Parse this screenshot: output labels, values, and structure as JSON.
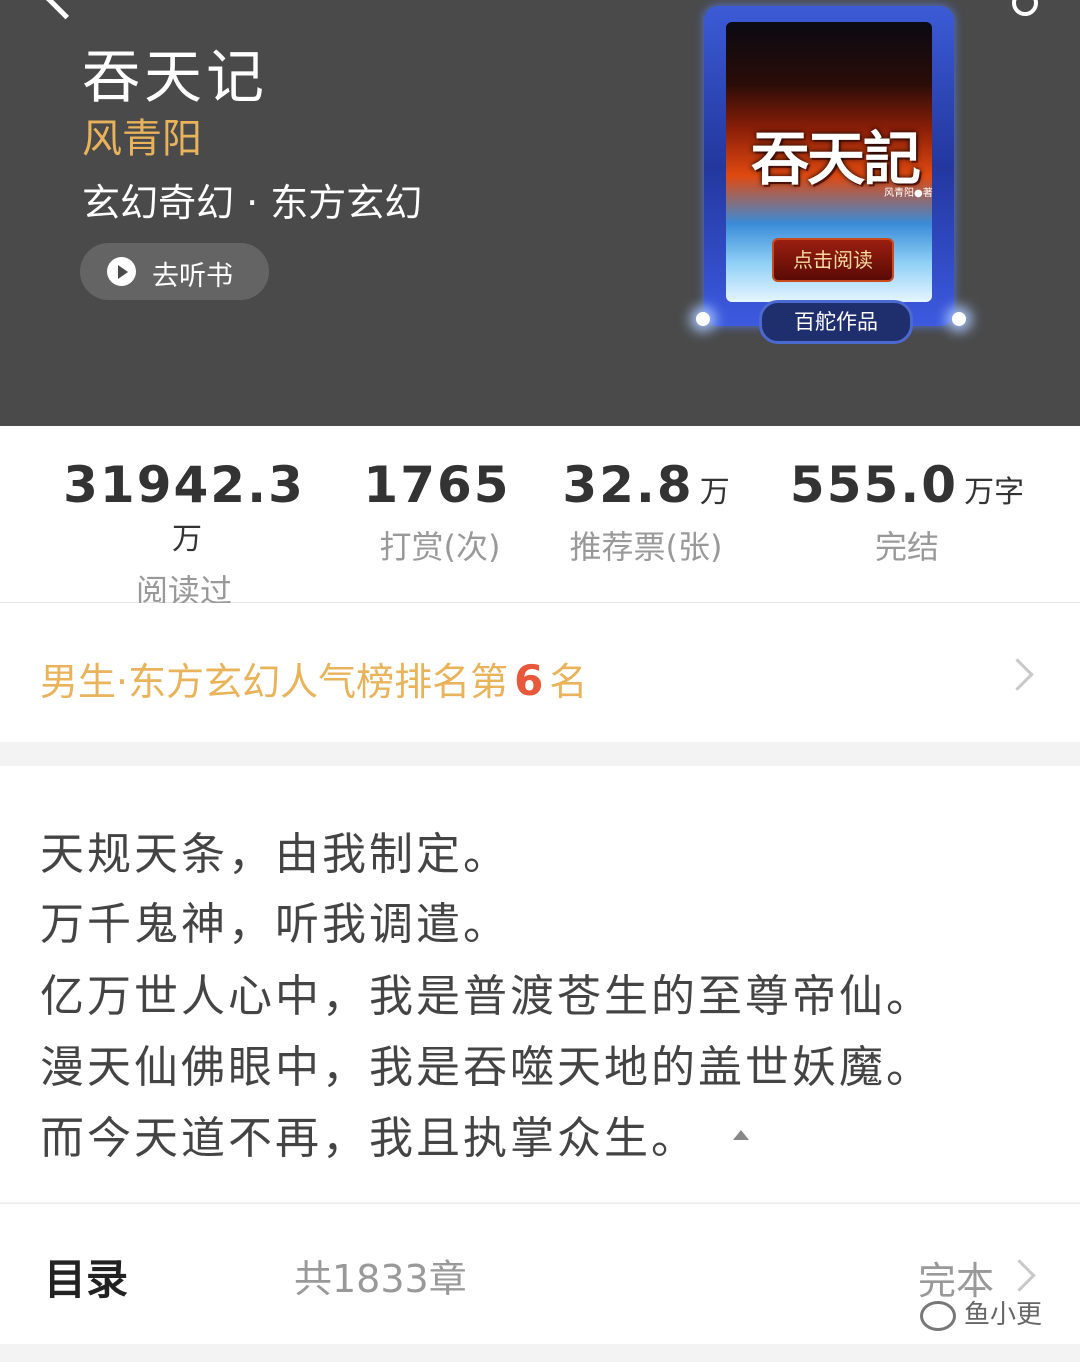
{
  "header": {
    "book_title": "吞天记",
    "author": "风青阳",
    "genre": "玄幻奇幻 · 东方玄幻",
    "listen_button": "去听书",
    "cover": {
      "title": "吞天記",
      "author_mark": "风青阳●著",
      "read_button": "点击阅读",
      "badge": "百舵作品"
    }
  },
  "stats": [
    {
      "value": "31942.3",
      "unit": "万",
      "label": "阅读过"
    },
    {
      "value": "1765",
      "unit": "",
      "label": "打赏(次)"
    },
    {
      "value": "32.8",
      "unit": "万",
      "label": "推荐票(张)"
    },
    {
      "value": "555.0",
      "unit": "万字",
      "label": "完结"
    }
  ],
  "ranking": {
    "prefix": "男生·东方玄幻人气榜排名第",
    "rank": "6",
    "suffix": "名"
  },
  "intro": [
    "天规天条，由我制定。",
    "万千鬼神，听我调遣。",
    "亿万世人心中，我是普渡苍生的至尊帝仙。",
    "漫天仙佛眼中，我是吞噬天地的盖世妖魔。",
    "而今天道不再，我且执掌众生。"
  ],
  "toc": {
    "title": "目录",
    "count": "共1833章",
    "status": "完本"
  },
  "watermark": "鱼小更",
  "colors": {
    "header_bg": "#4a4a4a",
    "author": "#e8b35a",
    "rank_text": "#e8b35a",
    "rank_number": "#e8583a"
  }
}
